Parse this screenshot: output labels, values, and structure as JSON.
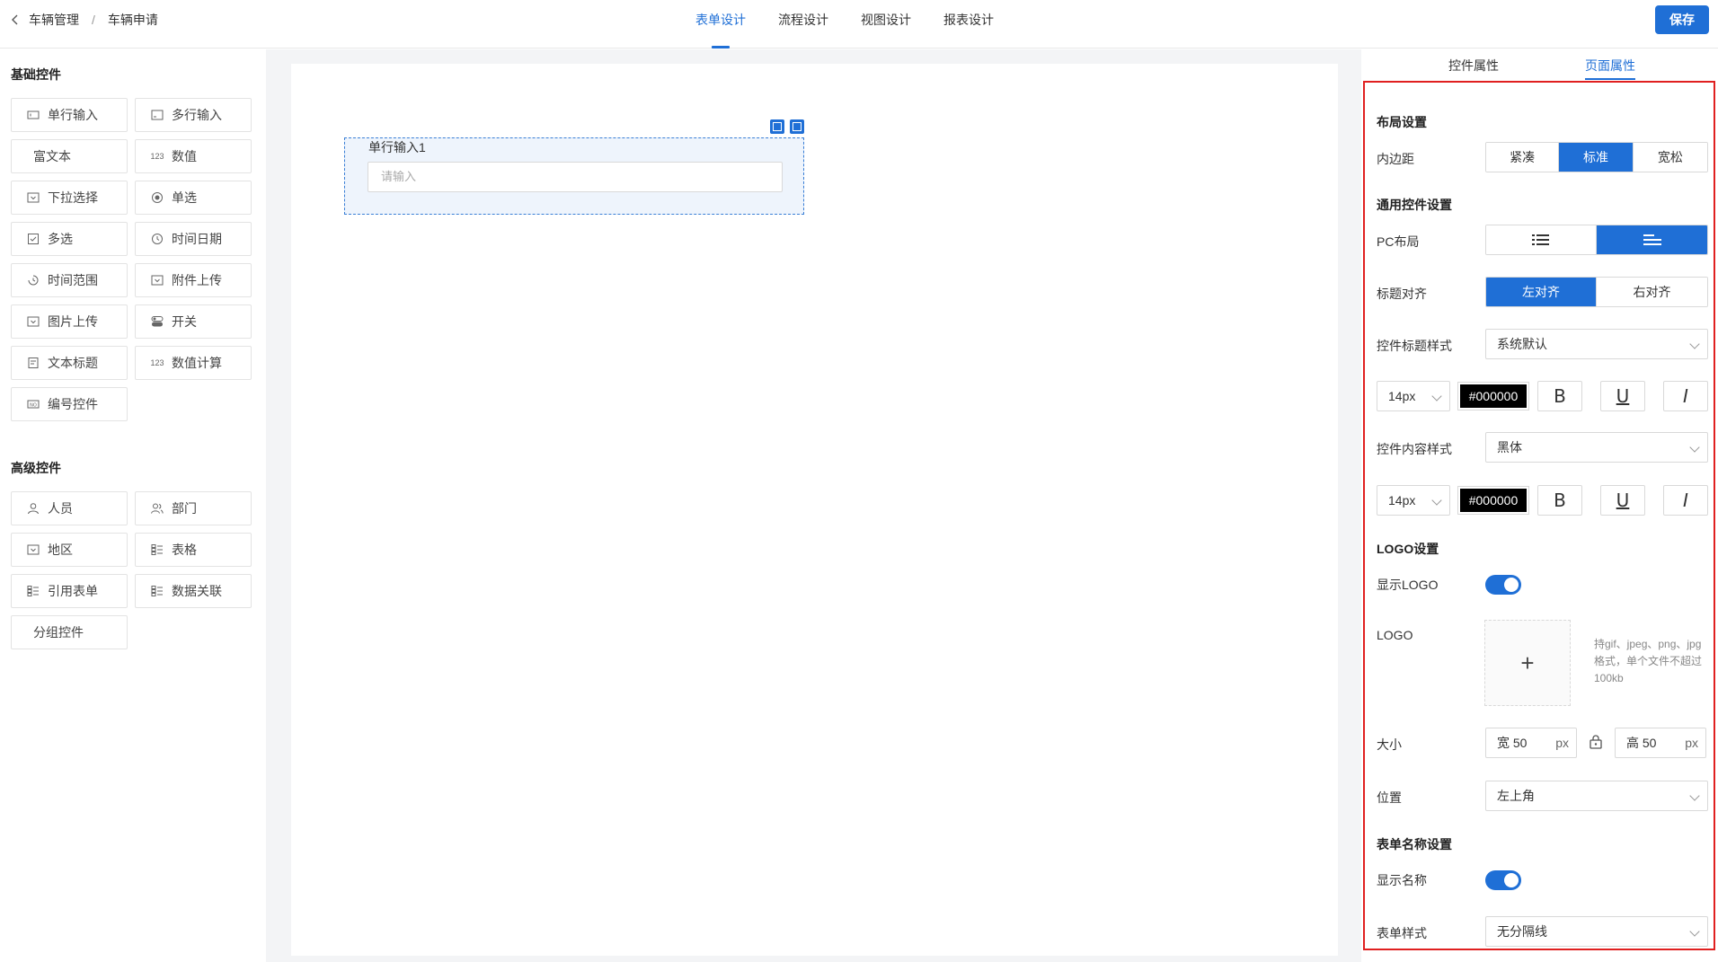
{
  "header": {
    "breadcrumb": [
      "车辆管理",
      "车辆申请"
    ],
    "tabs": [
      "表单设计",
      "流程设计",
      "视图设计",
      "报表设计"
    ],
    "active_tab": "表单设计",
    "save_label": "保存"
  },
  "left": {
    "basic_title": "基础控件",
    "basic_controls": [
      {
        "label": "单行输入",
        "icon": "input-icon"
      },
      {
        "label": "多行输入",
        "icon": "textarea-icon"
      },
      {
        "label": "富文本",
        "icon": ""
      },
      {
        "label": "数值",
        "icon": "number-123-icon"
      },
      {
        "label": "下拉选择",
        "icon": "dropdown-icon"
      },
      {
        "label": "单选",
        "icon": "radio-icon"
      },
      {
        "label": "多选",
        "icon": "checkbox-icon"
      },
      {
        "label": "时间日期",
        "icon": "clock-icon"
      },
      {
        "label": "时间范围",
        "icon": "time-range-icon"
      },
      {
        "label": "附件上传",
        "icon": "attachment-icon"
      },
      {
        "label": "图片上传",
        "icon": "image-icon"
      },
      {
        "label": "开关",
        "icon": "switch-icon"
      },
      {
        "label": "文本标题",
        "icon": "text-title-icon"
      },
      {
        "label": "数值计算",
        "icon": "number-123-icon"
      },
      {
        "label": "编号控件",
        "icon": "serial-number-icon"
      }
    ],
    "advanced_title": "高级控件",
    "advanced_controls": [
      {
        "label": "人员",
        "icon": "user-icon"
      },
      {
        "label": "部门",
        "icon": "department-icon"
      },
      {
        "label": "地区",
        "icon": "region-icon"
      },
      {
        "label": "表格",
        "icon": "table-icon"
      },
      {
        "label": "引用表单",
        "icon": "reference-form-icon"
      },
      {
        "label": "数据关联",
        "icon": "data-link-icon"
      },
      {
        "label": "分组控件",
        "icon": ""
      }
    ]
  },
  "canvas": {
    "field_label": "单行输入1",
    "field_placeholder": "请输入"
  },
  "right": {
    "tabs": [
      "控件属性",
      "页面属性"
    ],
    "active_tab": "页面属性",
    "layout_title": "布局设置",
    "padding_label": "内边距",
    "padding_options": [
      "紧凑",
      "标准",
      "宽松"
    ],
    "padding_selected": "标准",
    "common_title": "通用控件设置",
    "pc_layout_label": "PC布局",
    "pc_layout_selected": "horizontal",
    "title_align_label": "标题对齐",
    "title_align_options": [
      "左对齐",
      "右对齐"
    ],
    "title_align_selected": "左对齐",
    "title_style_label": "控件标题样式",
    "title_style_value": "系统默认",
    "title_font_size": "14px",
    "title_color": "#000000",
    "content_style_label": "控件内容样式",
    "content_style_value": "黑体",
    "content_font_size": "14px",
    "content_color": "#000000",
    "format_bold": "B",
    "format_underline": "U",
    "format_italic": "I",
    "logo_title": "LOGO设置",
    "show_logo_label": "显示LOGO",
    "show_logo": true,
    "logo_label": "LOGO",
    "upload_plus": "+",
    "logo_hint": "持gif、jpeg、png、jpg格式，单个文件不超过100kb",
    "size_label": "大小",
    "width_text": "宽 50",
    "height_text": "高 50",
    "unit": "px",
    "position_label": "位置",
    "position_value": "左上角",
    "form_name_title": "表单名称设置",
    "show_name_label": "显示名称",
    "show_name": true,
    "form_style_label": "表单样式",
    "form_style_value": "无分隔线"
  },
  "colors": {
    "accent": "#1f6fd6",
    "highlight_frame": "#e02020"
  }
}
